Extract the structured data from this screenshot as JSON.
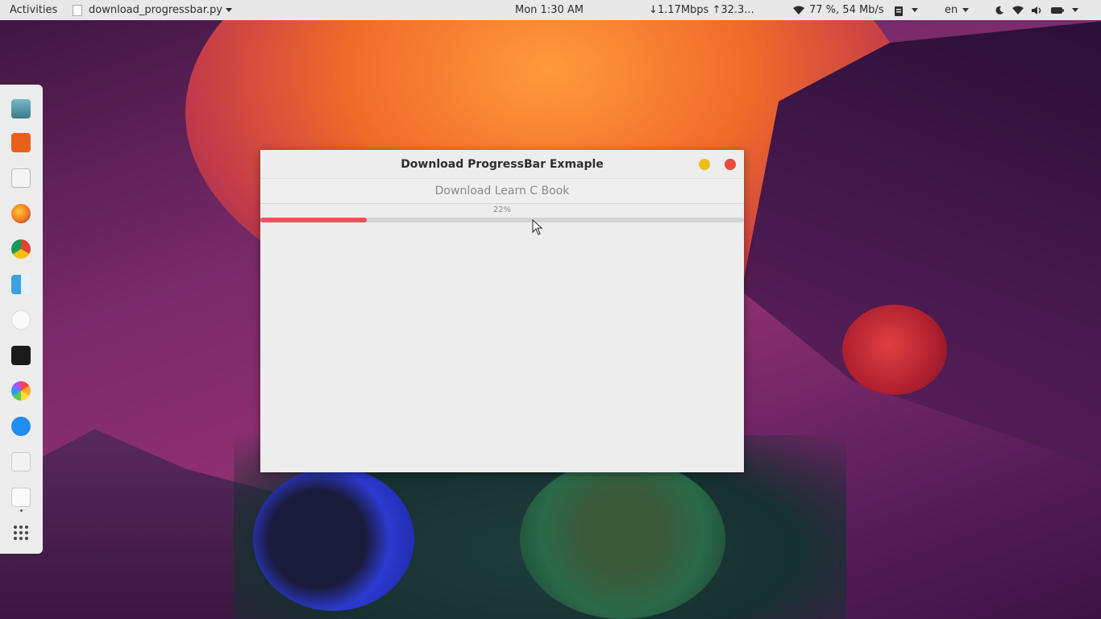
{
  "topbar": {
    "activities": "Activities",
    "app_name": "download_progressbar.py",
    "clock": "Mon  1:30 AM",
    "netspeed": "↓1.17Mbps ↑32.3...",
    "wifi_status": "77 %, 54 Mb/s",
    "language": "en"
  },
  "dock": {
    "items": [
      "trash-icon",
      "text-editor-icon",
      "screenshot-icon",
      "firefox-icon",
      "chrome-icon",
      "finder-icon",
      "music-icon",
      "terminal-icon",
      "photos-icon",
      "app-store-icon",
      "notes-icon",
      "blank-app-icon",
      "app-grid-icon"
    ]
  },
  "window": {
    "title": "Download ProgressBar Exmaple",
    "download_button_label": "Download Learn C Book",
    "progress_label": "22%",
    "progress_value": 0.22,
    "accent_color": "#f0505a",
    "minimize_color": "#f0be1c",
    "close_color": "#e74c3c"
  }
}
